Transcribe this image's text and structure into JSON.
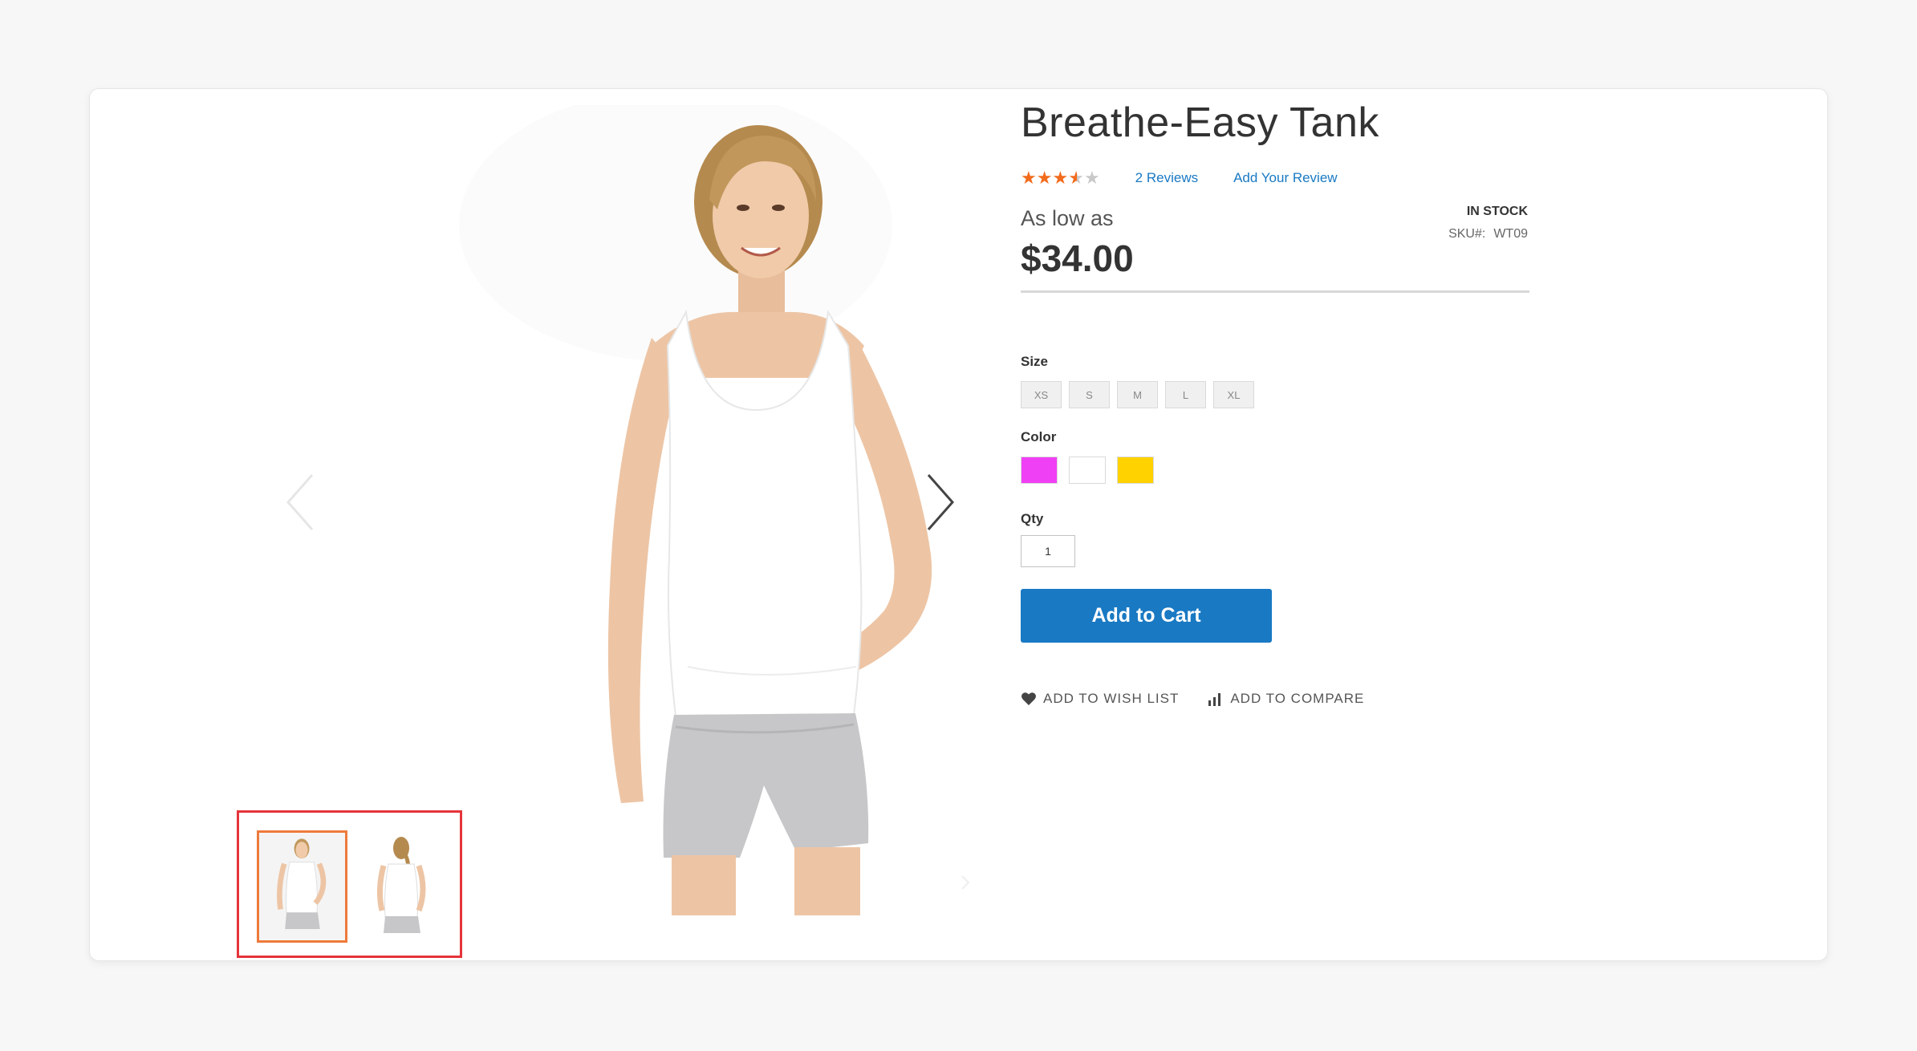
{
  "product": {
    "title": "Breathe-Easy Tank",
    "rating_fraction": 0.7,
    "reviews_link": "2  Reviews",
    "add_review_link": "Add Your Review",
    "price_prefix": "As low as",
    "price": "$34.00",
    "stock_status": "IN STOCK",
    "sku_label": "SKU#:",
    "sku_value": "WT09"
  },
  "options": {
    "size_label": "Size",
    "sizes": [
      "XS",
      "S",
      "M",
      "L",
      "XL"
    ],
    "color_label": "Color",
    "colors": [
      "#f040f5",
      "#ffffff",
      "#ffd200"
    ],
    "qty_label": "Qty",
    "qty_value": "1"
  },
  "buttons": {
    "add_to_cart": "Add to Cart",
    "add_to_wishlist": "ADD TO WISH LIST",
    "add_to_compare": "ADD TO COMPARE"
  },
  "gallery": {
    "thumbnail_count": 2,
    "active_thumbnail": 1
  },
  "colors": {
    "primary_button": "#1979c3",
    "link": "#1979c3",
    "star": "#f26b1d",
    "highlight_box": "#e5343a",
    "active_thumb_border": "#ee7a3b"
  }
}
